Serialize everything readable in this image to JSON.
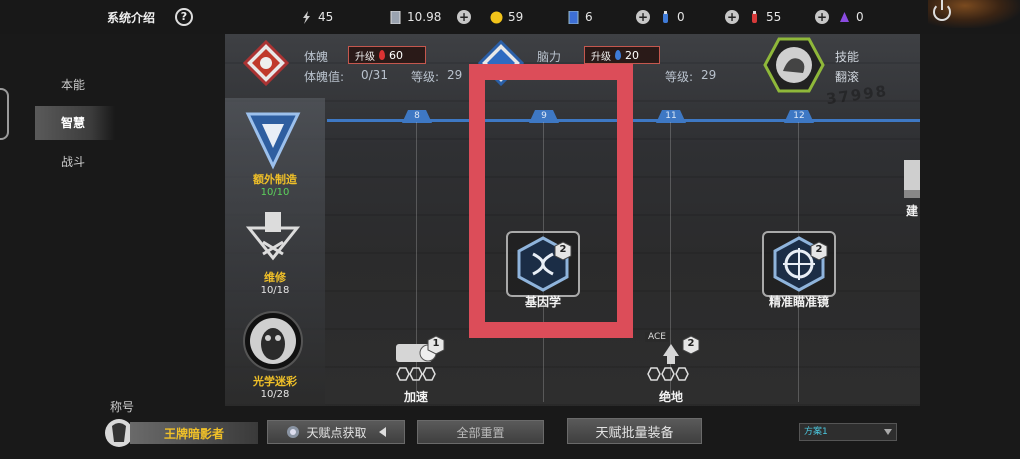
{
  "header": {
    "title": "系统介绍",
    "help_glyph": "?",
    "resources": [
      {
        "icon": "bolt-icon",
        "value": "45"
      },
      {
        "icon": "card-icon",
        "value": "10.98"
      },
      {
        "icon": "gold-coin-icon",
        "value": "59"
      },
      {
        "icon": "blue-card-icon",
        "value": "6"
      },
      {
        "icon": "blue-potion-icon",
        "value": "0"
      },
      {
        "icon": "red-potion-icon",
        "value": "55"
      },
      {
        "icon": "purple-crystal-icon",
        "value": "0"
      }
    ]
  },
  "left_nav": {
    "items": [
      {
        "label": "本能",
        "active": false
      },
      {
        "label": "智慧",
        "active": true
      },
      {
        "label": "战斗",
        "active": false
      }
    ]
  },
  "stats": {
    "physique": {
      "label": "体魄",
      "upgrade_label": "升级",
      "cost": "60",
      "value_label": "体魄值:",
      "value": "0/31",
      "level_label": "等级:",
      "level": "29"
    },
    "mind": {
      "label": "脑力",
      "upgrade_label": "升级",
      "cost": "20",
      "level_label": "等级:",
      "level": "29"
    },
    "skill": {
      "label": "技能",
      "sub": "翻滚"
    },
    "watermark": "37998"
  },
  "timeline": {
    "ticks": [
      "8",
      "9",
      "11",
      "12"
    ]
  },
  "side_talents": [
    {
      "name": "额外制造",
      "count": "10/10",
      "icon": "extra-craft-icon"
    },
    {
      "name": "维修",
      "count": "10/18",
      "icon": "repair-icon"
    },
    {
      "name": "光学迷彩",
      "count": "10/28",
      "icon": "optical-camo-icon"
    }
  ],
  "talents": {
    "genetics": {
      "name": "基因学",
      "badge": "2"
    },
    "precision_scope": {
      "name": "精准瞄准镜",
      "badge": "2"
    },
    "accelerate": {
      "name": "加速",
      "badge": "1"
    },
    "desperate": {
      "name": "绝地",
      "badge": "2",
      "tag": "ACE"
    },
    "build_partial": {
      "name": "建"
    }
  },
  "bottom": {
    "title_label": "称号",
    "title_name": "王牌暗影者",
    "get_points": "天赋点获取",
    "reset_all": "全部重置",
    "batch_equip": "天赋批量装备",
    "scheme": "方案1"
  },
  "colors": {
    "accent_blue": "#3e78c4",
    "highlight_red": "#dc4d59",
    "gold_text": "#f0c028",
    "green_text": "#5cd35c"
  }
}
